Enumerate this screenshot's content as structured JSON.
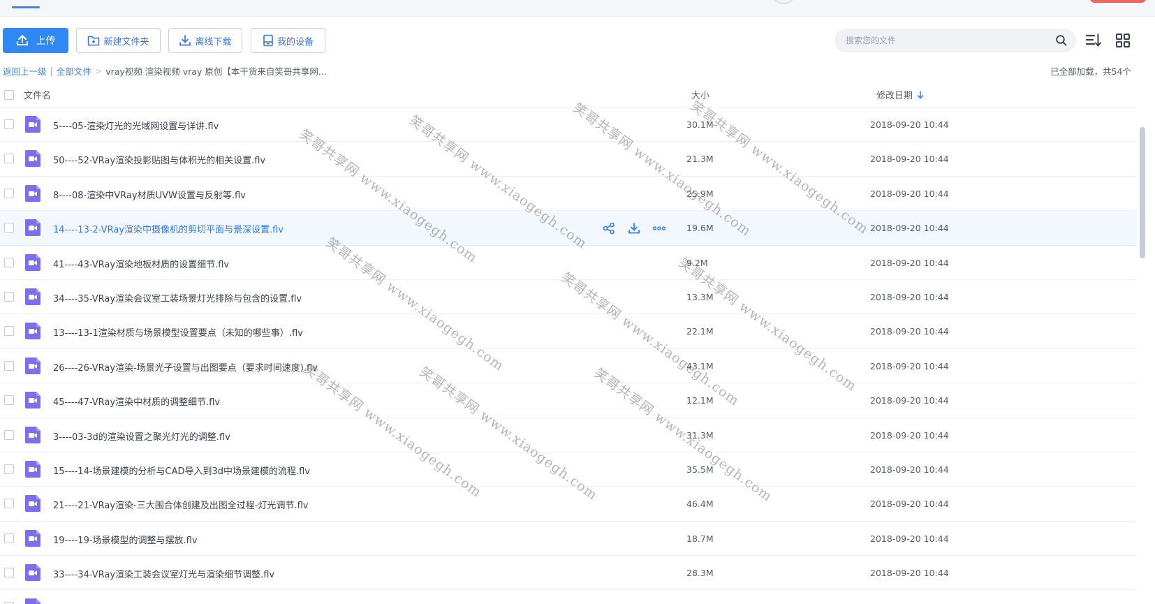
{
  "toolbar": {
    "upload_label": "上传",
    "new_folder_label": "新建文件夹",
    "offline_download_label": "离线下载",
    "my_devices_label": "我的设备"
  },
  "search": {
    "placeholder": "搜索您的文件"
  },
  "breadcrumb": {
    "back_label": "返回上一级",
    "separator": "|",
    "all_files_label": "全部文件",
    "arrow": ">",
    "current": "vray视频 渲染视频 vray 原创【本干货来自笑哥共享网..."
  },
  "status": {
    "loaded_text": "已全部加载，共54个"
  },
  "table": {
    "headers": {
      "name": "文件名",
      "size": "大小",
      "date": "修改日期"
    },
    "rows": [
      {
        "name": "5----05-渲染灯光的光域网设置与详讲.flv",
        "size": "30.1M",
        "date": "2018-09-20 10:44"
      },
      {
        "name": "50----52-VRay渲染投影贴图与体积光的相关设置.flv",
        "size": "21.3M",
        "date": "2018-09-20 10:44"
      },
      {
        "name": "8----08-渲染中VRay材质UVW设置与反射等.flv",
        "size": "25.9M",
        "date": "2018-09-20 10:44"
      },
      {
        "name": "14----13-2-VRay渲染中摄像机的剪切平面与景深设置.flv",
        "size": "19.6M",
        "date": "2018-09-20 10:44"
      },
      {
        "name": "41----43-VRay渲染地板材质的设置细节.flv",
        "size": "9.2M",
        "date": "2018-09-20 10:44"
      },
      {
        "name": "34----35-VRay渲染会议室工装场景灯光排除与包含的设置.flv",
        "size": "13.3M",
        "date": "2018-09-20 10:44"
      },
      {
        "name": "13----13-1渲染材质与场景模型设置要点（未知的哪些事）.flv",
        "size": "22.1M",
        "date": "2018-09-20 10:44"
      },
      {
        "name": "26----26-VRay渲染-场景光子设置与出图要点（要求时间速度).flv",
        "size": "43.1M",
        "date": "2018-09-20 10:44"
      },
      {
        "name": "45----47-VRay渲染中材质的调整细节.flv",
        "size": "12.1M",
        "date": "2018-09-20 10:44"
      },
      {
        "name": "3----03-3d的渲染设置之聚光灯光的调整.flv",
        "size": "31.3M",
        "date": "2018-09-20 10:44"
      },
      {
        "name": "15----14-场景建模的分析与CAD导入到3d中场景建模的流程.flv",
        "size": "35.5M",
        "date": "2018-09-20 10:44"
      },
      {
        "name": "21----21-VRay渲染-三大围合体创建及出图全过程-灯光调节.flv",
        "size": "46.4M",
        "date": "2018-09-20 10:44"
      },
      {
        "name": "19----19-场景模型的调整与摆放.flv",
        "size": "18.7M",
        "date": "2018-09-20 10:44"
      },
      {
        "name": "33----34-VRay渲染工装会议室灯光与渲染细节调整.flv",
        "size": "28.3M",
        "date": "2018-09-20 10:44"
      },
      {
        "name": "",
        "size": "",
        "date": ""
      }
    ]
  },
  "watermark": "笑哥共享网 www.xiaogegh.com",
  "colors": {
    "accent": "#2f88f3",
    "video_icon": "#7b6ff0",
    "hover_row": "#f3f7fe"
  }
}
